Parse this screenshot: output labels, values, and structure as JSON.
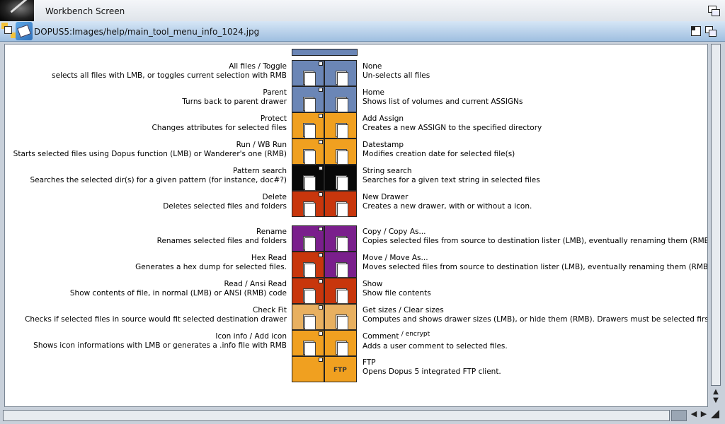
{
  "screen": {
    "title": "Workbench Screen"
  },
  "window": {
    "title": "DOPUS5:Images/help/main_tool_menu_info_1024.jpg"
  },
  "colors": {
    "blue": "#6b86b6",
    "orange": "#f0a020",
    "black": "#080808",
    "red": "#c8360c",
    "purple": "#7a1f8c",
    "tan": "#e8b060"
  },
  "rows": [
    {
      "left_title": "All files / Toggle",
      "left_desc": "selects all files with LMB, or toggles current selection with RMB",
      "right_title": "None",
      "right_desc": "Un-selects all files",
      "left_color": "#6b86b6",
      "right_color": "#6b86b6",
      "left_icon": "all-files-icon",
      "right_icon": "none-icon"
    },
    {
      "left_title": "Parent",
      "left_desc": "Turns back to parent drawer",
      "right_title": "Home",
      "right_desc": "Shows list of volumes and current ASSIGNs",
      "left_color": "#6b86b6",
      "right_color": "#6b86b6",
      "left_icon": "parent-icon",
      "right_icon": "home-icon"
    },
    {
      "left_title": "Protect",
      "left_desc": "Changes attributes for selected files",
      "right_title": "Add Assign",
      "right_desc": "Creates a new ASSIGN to the specified directory",
      "left_color": "#f0a020",
      "right_color": "#f0a020",
      "left_icon": "protect-icon",
      "right_icon": "add-assign-icon"
    },
    {
      "left_title": "Run / WB Run",
      "left_desc": "Starts selected files using Dopus function (LMB) or Wanderer's one (RMB)",
      "right_title": "Datestamp",
      "right_desc": "Modifies creation date for selected file(s)",
      "left_color": "#f0a020",
      "right_color": "#f0a020",
      "left_icon": "run-icon",
      "right_icon": "datestamp-icon"
    },
    {
      "left_title": "Pattern search",
      "left_desc": "Searches the selected dir(s) for a given pattern (for instance, doc#?)",
      "right_title": "String search",
      "right_desc": "Searches for a given text string in selected files",
      "left_color": "#080808",
      "right_color": "#080808",
      "left_icon": "pattern-search-icon",
      "right_icon": "string-search-icon"
    },
    {
      "left_title": "Delete",
      "left_desc": "Deletes selected files and folders",
      "right_title": "New Drawer",
      "right_desc": "Creates a new drawer, with or without a icon.",
      "left_color": "#c8360c",
      "right_color": "#c8360c",
      "left_icon": "delete-icon",
      "right_icon": "new-drawer-icon"
    },
    {
      "left_title": "Rename",
      "left_desc": "Renames selected files and folders",
      "right_title": "Copy / Copy As...",
      "right_desc": "Copies selected files from source to destination lister (LMB), eventually renaming them (RMB)",
      "left_color": "#7a1f8c",
      "right_color": "#7a1f8c",
      "left_icon": "rename-icon",
      "right_icon": "copy-icon"
    },
    {
      "left_title": "Hex Read",
      "left_desc": "Generates a hex dump for selected files.",
      "right_title": "Move / Move As...",
      "right_desc": "Moves selected files from source to destination lister (LMB), eventually renaming them (RMB)",
      "left_color": "#c8360c",
      "right_color": "#7a1f8c",
      "left_icon": "hex-read-icon",
      "right_icon": "move-icon"
    },
    {
      "left_title": "Read / Ansi Read",
      "left_desc": "Show contents of file, in normal (LMB) or ANSI (RMB) code",
      "right_title": "Show",
      "right_desc": "Show file contents",
      "left_color": "#c8360c",
      "right_color": "#c8360c",
      "left_icon": "read-icon",
      "right_icon": "show-icon"
    },
    {
      "left_title": "Check Fit",
      "left_desc": "Checks if selected files in source would fit selected destination drawer",
      "right_title": "Get sizes / Clear sizes",
      "right_desc": "Computes and shows drawer sizes (LMB), or hide them (RMB). Drawers must be selected first.",
      "left_color": "#e8b060",
      "right_color": "#e8b060",
      "left_icon": "check-fit-icon",
      "right_icon": "get-sizes-icon"
    },
    {
      "left_title": "Icon info / Add icon",
      "left_desc": "Shows icon informations with LMB or generates a .info file with RMB",
      "right_title": "Comment",
      "right_title_sup": "/ encrypt",
      "right_desc": "Adds a user comment to selected files.",
      "left_color": "#f0a020",
      "right_color": "#f0a020",
      "left_icon": "icon-info-icon",
      "right_icon": "comment-icon"
    },
    {
      "left_title": "",
      "left_desc": "",
      "right_title": "FTP",
      "right_desc": "Opens Dopus 5 integrated FTP client.",
      "left_color": "#f0a020",
      "right_color": "#f0a020",
      "left_icon": "",
      "right_icon": "ftp-icon",
      "right_icon_text": "FTP"
    }
  ]
}
